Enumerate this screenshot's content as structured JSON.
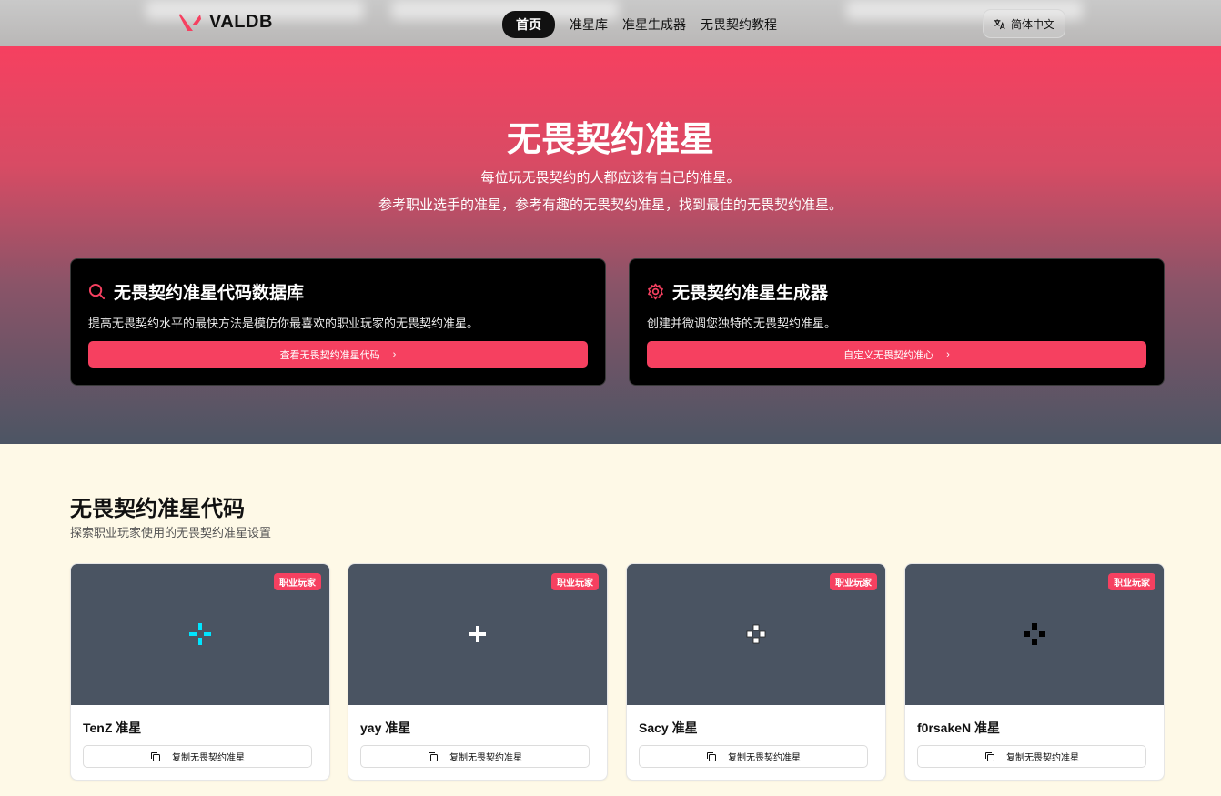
{
  "header": {
    "brand": "VALDB",
    "nav": [
      "首页",
      "准星库",
      "准星生成器",
      "无畏契约教程"
    ],
    "language": "简体中文"
  },
  "hero": {
    "title": "无畏契约准星",
    "subtitle_line1": "每位玩无畏契约的人都应该有自己的准星。",
    "subtitle_line2": "参考职业选手的准星，参考有趣的无畏契约准星，找到最佳的无畏契约准星。"
  },
  "features": [
    {
      "icon": "search-icon",
      "title": "无畏契约准星代码数据库",
      "desc": "提高无畏契约水平的最快方法是模仿你最喜欢的职业玩家的无畏契约准星。",
      "button": "查看无畏契约准星代码"
    },
    {
      "icon": "gear-icon",
      "title": "无畏契约准星生成器",
      "desc": "创建并微调您独特的无畏契约准星。",
      "button": "自定义无畏契约准心"
    }
  ],
  "section": {
    "title": "无畏契约准星代码",
    "subtitle": "探索职业玩家使用的无畏契约准星设置"
  },
  "cards": [
    {
      "name": "TenZ 准星",
      "badge": "职业玩家",
      "copy": "复制无畏契约准星",
      "crosshair_color": "#00e5ff"
    },
    {
      "name": "yay 准星",
      "badge": "职业玩家",
      "copy": "复制无畏契约准星",
      "crosshair_color": "#ffffff"
    },
    {
      "name": "Sacy 准星",
      "badge": "职业玩家",
      "copy": "复制无畏契约准星",
      "crosshair_color": "#ffffff"
    },
    {
      "name": "f0rsakeN 准星",
      "badge": "职业玩家",
      "copy": "复制无畏契约准星",
      "crosshair_color": "#000000"
    }
  ],
  "colors": {
    "accent": "#f64060",
    "preview_bg": "#4a5462",
    "section_bg": "#fef9e7"
  }
}
